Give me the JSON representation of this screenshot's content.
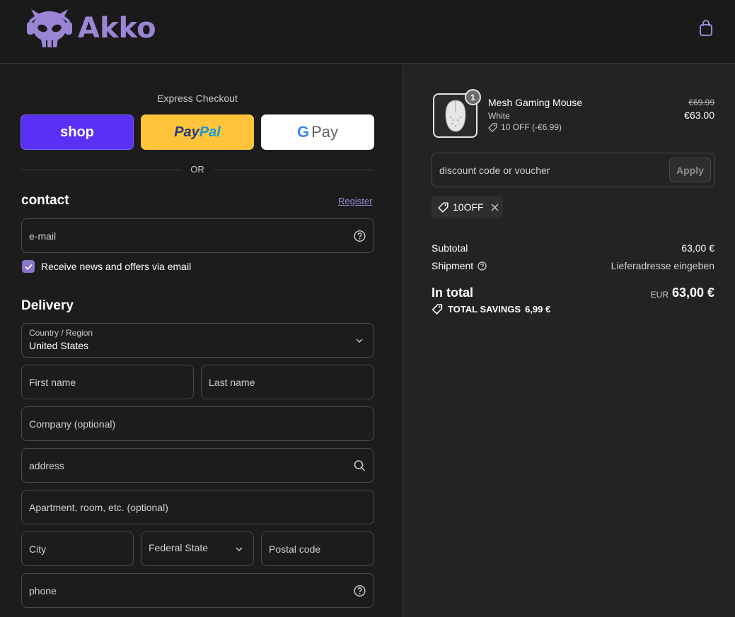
{
  "header": {
    "brand": "Akko",
    "icons": {
      "logo": "akko-skull-logo",
      "cart": "shopping-bag-icon"
    }
  },
  "express": {
    "title": "Express Checkout",
    "shop_label": "shop",
    "paypal_label_1": "Pay",
    "paypal_label_2": "Pal",
    "gpay_g": "G",
    "gpay_label": "Pay",
    "or": "OR"
  },
  "contact": {
    "title": "contact",
    "register": "Register",
    "email_placeholder": "e-mail",
    "newsletter_label": "Receive news and offers via email",
    "newsletter_checked": true
  },
  "delivery": {
    "title": "Delivery",
    "country_label": "Country / Region",
    "country_value": "United States",
    "first_name": "First name",
    "last_name": "Last name",
    "company": "Company (optional)",
    "address": "address",
    "apartment": "Apartment, room, etc. (optional)",
    "city": "City",
    "state": "Federal State",
    "postal": "Postal code",
    "phone": "phone"
  },
  "order": {
    "item": {
      "name": "Mesh Gaming Mouse",
      "variant": "White",
      "quantity": "1",
      "discount": "10 OFF (-€6.99)",
      "old_price": "€69.99",
      "price": "€63.00"
    },
    "discount_placeholder": "discount code or voucher",
    "apply": "Apply",
    "applied_code": "10OFF",
    "subtotal_label": "Subtotal",
    "subtotal_value": "63,00 €",
    "shipment_label": "Shipment",
    "shipment_value": "Lieferadresse eingeben",
    "total_label": "In total",
    "total_currency": "EUR",
    "total_value": "63,00 €",
    "savings_label": "TOTAL SAVINGS",
    "savings_value": "6,99 €"
  },
  "colors": {
    "accent": "#9b86d6",
    "shop": "#5a31f4",
    "paypal": "#ffc439",
    "background": "#1c1c1c",
    "summary_background": "#232323"
  }
}
